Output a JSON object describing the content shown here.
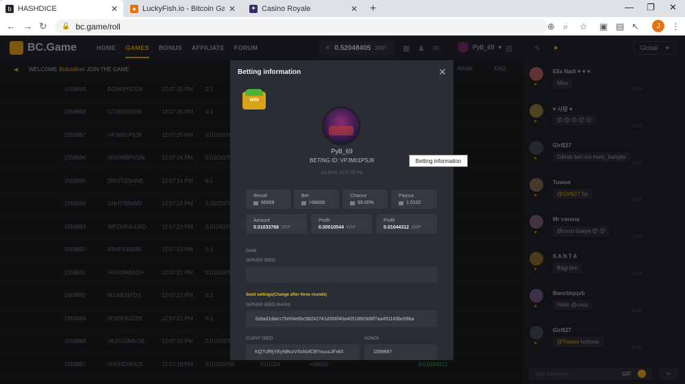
{
  "browser": {
    "tabs": [
      {
        "title": "HASHDICE",
        "fav_color": "#1f2430"
      },
      {
        "title": "LuckyFish.io - Bitcoin Gambling S",
        "fav_color": "#e8710a"
      },
      {
        "title": "Casino Royale",
        "fav_color": "#3b2a6a"
      }
    ],
    "url": "bc.game/roll",
    "profile_initial": "J",
    "new_tab": "+",
    "close_glyph": "✕"
  },
  "header": {
    "logo": "BC.Game",
    "nav": [
      "HOME",
      "GAMES",
      "BONUS",
      "AFFILIATE",
      "FORUM"
    ],
    "active_nav": "GAMES",
    "balance": "0.52048405",
    "currency": "XRP",
    "username": "PyB_69",
    "region": "Global"
  },
  "welcome": {
    "prefix": "WELCOME",
    "name": "BobooKiet",
    "suffix": "JOIN THE GAME"
  },
  "side_links": {
    "rank": "RANK",
    "faq": "FAQ"
  },
  "background_rows": [
    {
      "id": "1558898",
      "bet_id": "BO0K9Y87OX",
      "time": "12:07:25 PM",
      "val": "0.1"
    },
    {
      "id": "1558898",
      "bet_id": "G728DX8S5B",
      "time": "12:07:26 PM",
      "val": "0.1"
    },
    {
      "id": "1558897",
      "bet_id": "VPJM01PSJ9",
      "time": "12:07:25 PM",
      "val": "0.01033768"
    },
    {
      "id": "1558896",
      "bet_id": "MODMBPVSW",
      "time": "12:07:24 PM",
      "val": "0.01033768"
    },
    {
      "id": "1558895",
      "bet_id": "DRGTIZSHNB",
      "time": "12:07:24 PM",
      "val": "0.1"
    },
    {
      "id": "1558894",
      "bet_id": "CNHYS9W9D",
      "time": "12:07:24 PM",
      "val": "0.01033768"
    },
    {
      "id": "1558893",
      "bet_id": "WPZKRNLLWD",
      "time": "12:07:23 PM",
      "val": "0.01033768"
    },
    {
      "id": "1558892",
      "bet_id": "R6HFX30B85",
      "time": "12:07:23 PM",
      "val": "0.1"
    },
    {
      "id": "1558891",
      "bet_id": "FHV43NBKZH",
      "time": "12:07:22 PM",
      "val": "0.01033768"
    },
    {
      "id": "1558890",
      "bet_id": "M1IXB31FDS",
      "time": "12:07:22 PM",
      "val": "0.1"
    },
    {
      "id": "1558889",
      "bet_id": "M1B9O6J2ZH",
      "time": "12:07:21 PM",
      "val": "0.1"
    },
    {
      "id": "1558888",
      "bet_id": "VEZG3JMKOB",
      "time": "12:07:20 PM",
      "val": "0.01033768"
    },
    {
      "id": "1558887",
      "bet_id": "VHUHD0R4J5",
      "time": "12:07:19 PM",
      "val": "0.01033768",
      "extra1": "0.01024",
      "extra2": "+99000",
      "win": "0.01044312"
    }
  ],
  "chat": {
    "messages": [
      {
        "user": "Ella Nadi ♥ ♥ ♥",
        "text": "Miss",
        "time": "12:07",
        "color": "#b06060"
      },
      {
        "user": "♥ 사랑 ♥",
        "text": "😊 😊 😊 😊 😊",
        "time": "12:07",
        "color": "#8a7a40"
      },
      {
        "user": "Girl$27",
        "text": "Giliran bet nrd mulu_bangke",
        "time": "12:07",
        "color": "#444a52"
      },
      {
        "user": "Towew",
        "mention": "@Girl$27",
        "text": "ha",
        "time": "12:07",
        "color": "#7a6a50"
      },
      {
        "user": "Mr corona",
        "text": "@coco buaya 😊 😊",
        "time": "12:07",
        "color": "#806070"
      },
      {
        "user": "S A N T A",
        "text": "Bagi bro",
        "time": "12:07",
        "color": "#8a6a30"
      },
      {
        "user": "Bwnrbtqqvb",
        "text": "Hello @coco",
        "time": "12:07",
        "color": "#705a80"
      },
      {
        "user": "Girl$27",
        "mention": "@Towew",
        "text": "hohooo",
        "time": "12:07",
        "color": "#444a52"
      }
    ],
    "input_placeholder": "Your Message",
    "gif": "GIF",
    "send": "➤"
  },
  "modal": {
    "title": "Betting information",
    "win_badge": "WIN",
    "name": "PyB_69",
    "bet_id_label": "BETING ID: VPJM01PSJ9",
    "datetime": "5/1/2020, 12:07:25 PM",
    "stats": [
      {
        "label": "Result",
        "value": "66669"
      },
      {
        "label": "Bet",
        "value": ">99000"
      },
      {
        "label": "Chance",
        "value": "99.00%"
      },
      {
        "label": "Payout",
        "value": "1.0102"
      }
    ],
    "amounts": [
      {
        "label": "Amount",
        "value": "0.01033768",
        "unit": "XRP"
      },
      {
        "label": "Profit",
        "value": "0.00010544",
        "unit": "XRP"
      },
      {
        "label": "Profit",
        "value": "0.01044312",
        "unit": "XRP"
      }
    ],
    "detail_label": "Detail",
    "server_seed_label": "SERVER SEED",
    "server_seed_value": "",
    "seed_settings_label": "Seed settings(Change after three rounds)",
    "server_seed_hash_label": "SERVER SEED (HASH)",
    "server_seed_hash": "1b9ad1dae175e04e0bc58242741d356f40a40518603d8f7aa491163bc09ba",
    "client_seed_label": "CLIENT SEED",
    "client_seed": "KQ7UfRjYEyNBvzVXoNxfCBYxuuuJFxk5",
    "nonce_label": "NONCE",
    "nonce": "1558697"
  },
  "tooltip": "Betting information"
}
